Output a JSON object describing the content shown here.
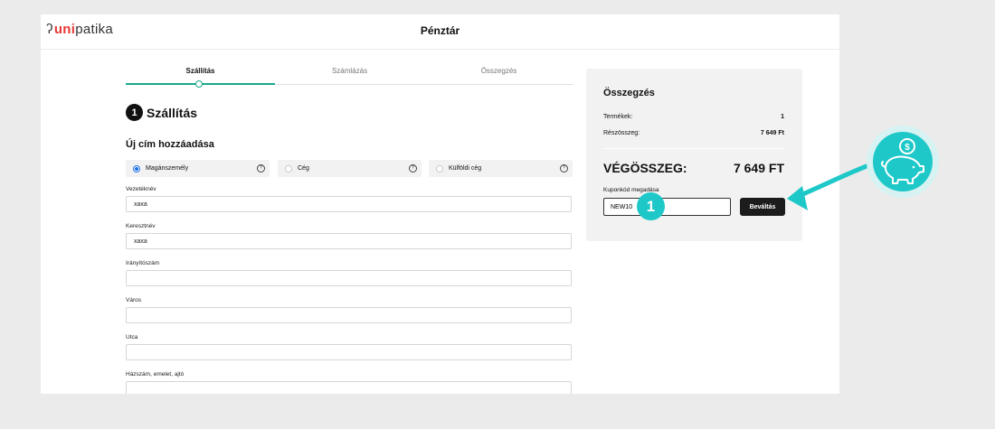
{
  "header": {
    "logo_prefix": "uni",
    "logo_suffix": "patika",
    "title": "Pénztár"
  },
  "steps": [
    {
      "label": "Szállítás",
      "active": true
    },
    {
      "label": "Számlázás",
      "active": false
    },
    {
      "label": "Összegzés",
      "active": false
    }
  ],
  "section": {
    "number": "1",
    "title": "Szállítás",
    "subtitle": "Új cím hozzáadása"
  },
  "customer_types": [
    {
      "label": "Magánszemély",
      "selected": true
    },
    {
      "label": "Cég",
      "selected": false
    },
    {
      "label": "Külföldi cég",
      "selected": false
    }
  ],
  "form": {
    "last_name_label": "Vezetéknév",
    "last_name_value": "xaxa",
    "first_name_label": "Keresztnév",
    "first_name_value": "xaxa",
    "zip_label": "Irányítószám",
    "zip_value": "",
    "city_label": "Város",
    "city_value": "",
    "street_label": "Utca",
    "street_value": "",
    "house_label": "Házszám, emelet, ajtó",
    "house_value": ""
  },
  "summary": {
    "title": "Összegzés",
    "products_label": "Termékek:",
    "products_value": "1",
    "subtotal_label": "Részösszeg:",
    "subtotal_value": "7 649 Ft",
    "total_label": "VÉGÖSSZEG:",
    "total_value": "7 649 FT",
    "coupon_label": "Kuponkód megadása",
    "coupon_value": "NEW10",
    "redeem_label": "Beváltás"
  },
  "annotation": {
    "badge_number": "1"
  },
  "colors": {
    "accent_green": "#1aa98a",
    "teal_annotation": "#1ec8c8",
    "logo_red": "#e53935",
    "button_dark": "#1c1c1c"
  }
}
